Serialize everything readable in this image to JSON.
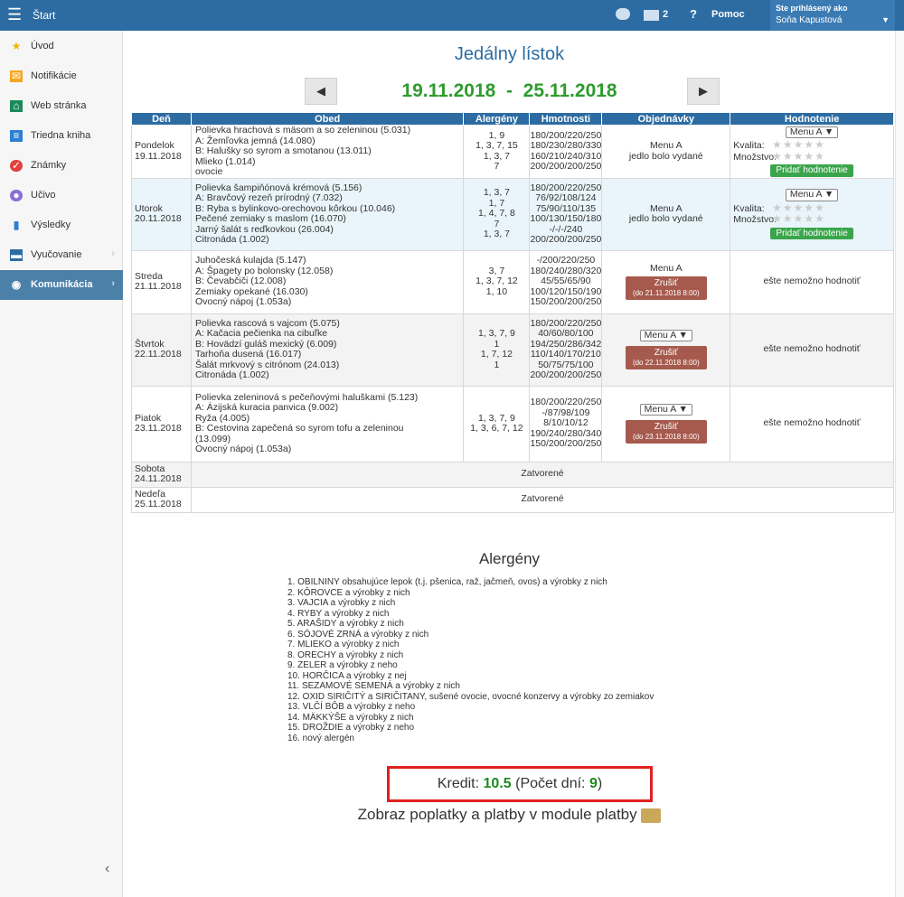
{
  "topbar": {
    "start": "Štart",
    "mail_count": "2",
    "help": "Pomoc",
    "user_label": "Ste prihlásený ako",
    "user_name": "Soňa Kapustová"
  },
  "sidebar": {
    "items": [
      {
        "label": "Úvod",
        "icon": "star-icon",
        "color": "#f4b400"
      },
      {
        "label": "Notifikácie",
        "icon": "envelope-icon",
        "color": "#f4a623"
      },
      {
        "label": "Web stránka",
        "icon": "home-icon",
        "color": "#1a8a5a"
      },
      {
        "label": "Triedna kniha",
        "icon": "book-icon",
        "color": "#2b7fd6"
      },
      {
        "label": "Známky",
        "icon": "grade-icon",
        "color": "#e04040"
      },
      {
        "label": "Učivo",
        "icon": "graduation-icon",
        "color": "#8e6fd1"
      },
      {
        "label": "Výsledky",
        "icon": "bar-chart-icon",
        "color": "#2b7fd6"
      },
      {
        "label": "Vyučovanie",
        "icon": "school-icon",
        "color": "#2d6ca2"
      },
      {
        "label": "Komunikácia",
        "icon": "chat-icon",
        "color": "#ffffff"
      }
    ]
  },
  "page": {
    "title": "Jedálny lístok",
    "date_range": "19.11.2018  -  25.11.2018"
  },
  "table": {
    "headers": [
      "Deň",
      "Obed",
      "Alergény",
      "Hmotnosti",
      "Objednávky",
      "Hodnotenie"
    ],
    "rate_quality": "Kvalita:",
    "rate_quantity": "Množstvo:",
    "rate_button": "Pridať hodnotenie",
    "menu_select": "Menu A ▼",
    "cancel": "Zrušiť",
    "not_yet": "ešte nemožno hodnotiť",
    "closed": "Zatvorené",
    "rows": [
      {
        "day": "Pondelok",
        "date": "19.11.2018",
        "meals": [
          "Polievka hrachová s mäsom a so zeleninou (5.031)",
          "A: Žemľovka jemná (14.080)",
          "B: Halušky so syrom a smotanou (13.011)",
          "Mlieko (1.014)",
          "ovocie"
        ],
        "allergens": [
          "1, 9",
          "1, 3, 7, 15",
          "1, 3, 7",
          "7",
          ""
        ],
        "weights": [
          "180/200/220/250",
          "180/230/280/330",
          "160/210/240/310",
          "200/200/200/250",
          ""
        ],
        "order": "Menu A",
        "order_note": "jedlo bolo vydané"
      },
      {
        "day": "Utorok",
        "date": "20.11.2018",
        "meals": [
          "Polievka šampiňónová krémová (5.156)",
          "A: Bravčový rezeň prírodný (7.032)",
          "B: Ryba s bylinkovo-orechovou kôrkou (10.046)",
          "Pečené zemiaky s maslom (16.070)",
          "Jarný šalát s reďkovkou (26.004)",
          "Citronáda (1.002)"
        ],
        "allergens": [
          "1, 3, 7",
          "1, 7",
          "1, 4, 7, 8",
          "7",
          "1, 3, 7",
          ""
        ],
        "weights": [
          "180/200/220/250",
          "76/92/108/124",
          "75/90/110/135",
          "100/130/150/180",
          "-/-/-/240",
          "200/200/200/250"
        ],
        "order": "Menu A",
        "order_note": "jedlo bolo vydané"
      },
      {
        "day": "Streda",
        "date": "21.11.2018",
        "meals": [
          "Juhočeská kulajda (5.147)",
          "A: Špagety po bolonsky (12.058)",
          "B: Čevabčiči (12.008)",
          "Zemiaky opekané (16.030)",
          "Ovocný nápoj (1.053a)"
        ],
        "allergens": [
          "3, 7",
          "1, 3, 7, 12",
          "1, 10",
          "",
          ""
        ],
        "weights": [
          "-/200/220/250",
          "180/240/280/320",
          "45/55/65/90",
          "100/120/150/190",
          "150/200/200/250"
        ],
        "order": "Menu A",
        "deadline": "(do 21.11.2018 8:00)"
      },
      {
        "day": "Štvrtok",
        "date": "22.11.2018",
        "meals": [
          "Polievka rascová s vajcom (5.075)",
          "A: Kačacia pečienka na cibuľke",
          "B: Hovädzí guláš mexický (6.009)",
          "Tarhoňa dusená (16.017)",
          "Šalát mrkvový s citrónom (24.013)",
          "Citronáda (1.002)"
        ],
        "allergens": [
          "1, 3, 7, 9",
          "1",
          "1, 7, 12",
          "1",
          "",
          ""
        ],
        "weights": [
          "180/200/220/250",
          "40/60/80/100",
          "194/250/286/342",
          "110/140/170/210",
          "50/75/75/100",
          "200/200/200/250"
        ],
        "deadline": "(do 22.11.2018 8:00)"
      },
      {
        "day": "Piatok",
        "date": "23.11.2018",
        "meals": [
          "Polievka zeleninová s pečeňovými haluškami (5.123)",
          "A: Ázijská kuracia panvica (9.002)",
          "Ryža (4.005)",
          "B: Cestovina zapečená so syrom tofu a zeleninou",
          "(13.099)",
          "Ovocný nápoj (1.053a)"
        ],
        "allergens": [
          "1, 3, 7, 9",
          "",
          "",
          "1, 3, 6, 7, 12",
          "",
          ""
        ],
        "weights": [
          "180/200/220/250",
          "-/87/98/109",
          "8/10/10/12",
          "190/240/280/340",
          "",
          "150/200/200/250"
        ],
        "deadline": "(do 23.11.2018 8:00)"
      },
      {
        "day": "Sobota",
        "date": "24.11.2018"
      },
      {
        "day": "Nedeľa",
        "date": "25.11.2018"
      }
    ]
  },
  "allergens_title": "Alergény",
  "allergens": [
    "1. OBILNINY obsahujúce lepok (t.j. pšenica, raž, jačmeň, ovos) a výrobky z nich",
    "2. KÔROVCE a výrobky z nich",
    "3. VAJCIA a výrobky z nich",
    "4. RYBY a výrobky z nich",
    "5. ARAŠIDY a výrobky z nich",
    "6. SÓJOVÉ ZRNÁ a výrobky z nich",
    "7. MLIEKO a výrobky z nich",
    "8. ORECHY a výrobky z nich",
    "9. ZELER a výrobky z neho",
    "10. HORČICA a výrobky z nej",
    "11. SEZAMOVÉ SEMENÁ a výrobky z nich",
    "12. OXID SIRIČITÝ a SIRIČITANY, sušené ovocie, ovocné konzervy a výrobky zo zemiakov",
    "13. VLČÍ BÔB a výrobky z neho",
    "14. MÄKKÝŠE a výrobky z nich",
    "15. DROŽDIE a výrobky z neho",
    "16. nový alergén"
  ],
  "credit": {
    "label": "Kredit:",
    "value": "10.5",
    "days_label": "(Počet dní:",
    "days": "9",
    "close": ")"
  },
  "payments_text": "Zobraz poplatky a platby v module platby"
}
